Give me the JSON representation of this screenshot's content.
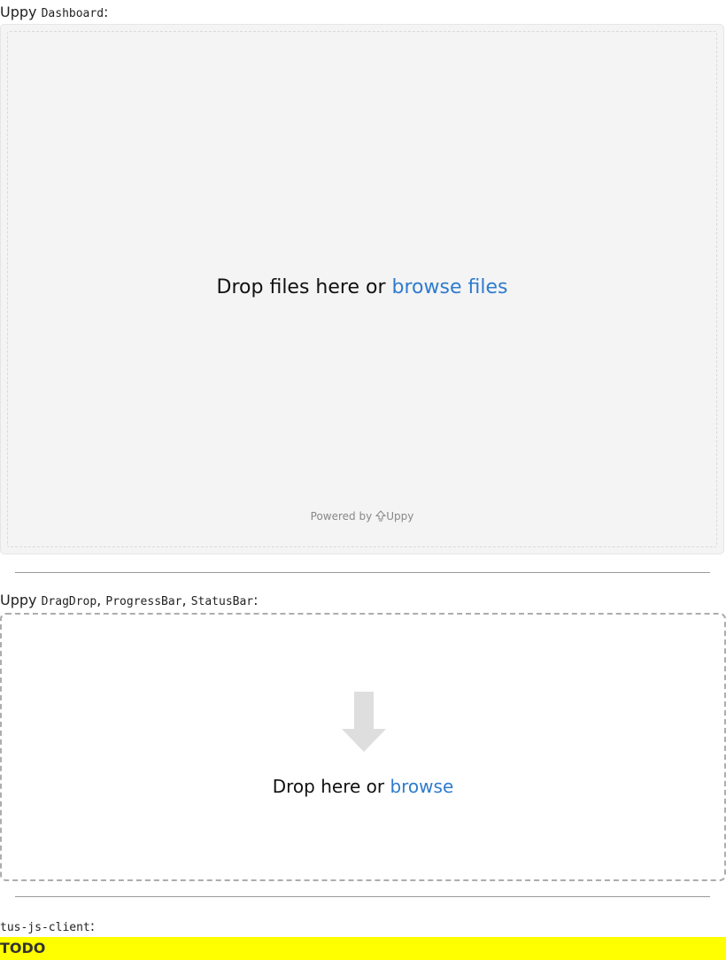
{
  "sections": {
    "dashboard": {
      "prefix": "Uppy",
      "code": "Dashboard",
      "suffix": ":"
    },
    "dragdrop": {
      "prefix": "Uppy",
      "code1": "DragDrop",
      "sep1": ",",
      "code2": "ProgressBar",
      "sep2": ",",
      "code3": "StatusBar",
      "suffix": ":"
    },
    "tus": {
      "code": "tus-js-client",
      "suffix": ":"
    }
  },
  "dashboard": {
    "drop_text": "Drop files here or",
    "browse_link": "browse files",
    "powered_by": "Powered by",
    "powered_brand": "Uppy"
  },
  "dragdrop": {
    "drop_text": "Drop here or",
    "browse_link": "browse",
    "icon": "arrow-down-icon"
  },
  "todo": {
    "text": "TODO",
    "background": "#ffff00"
  },
  "colors": {
    "link": "#2e7bcf",
    "dashboard_bg": "#f4f4f4"
  }
}
